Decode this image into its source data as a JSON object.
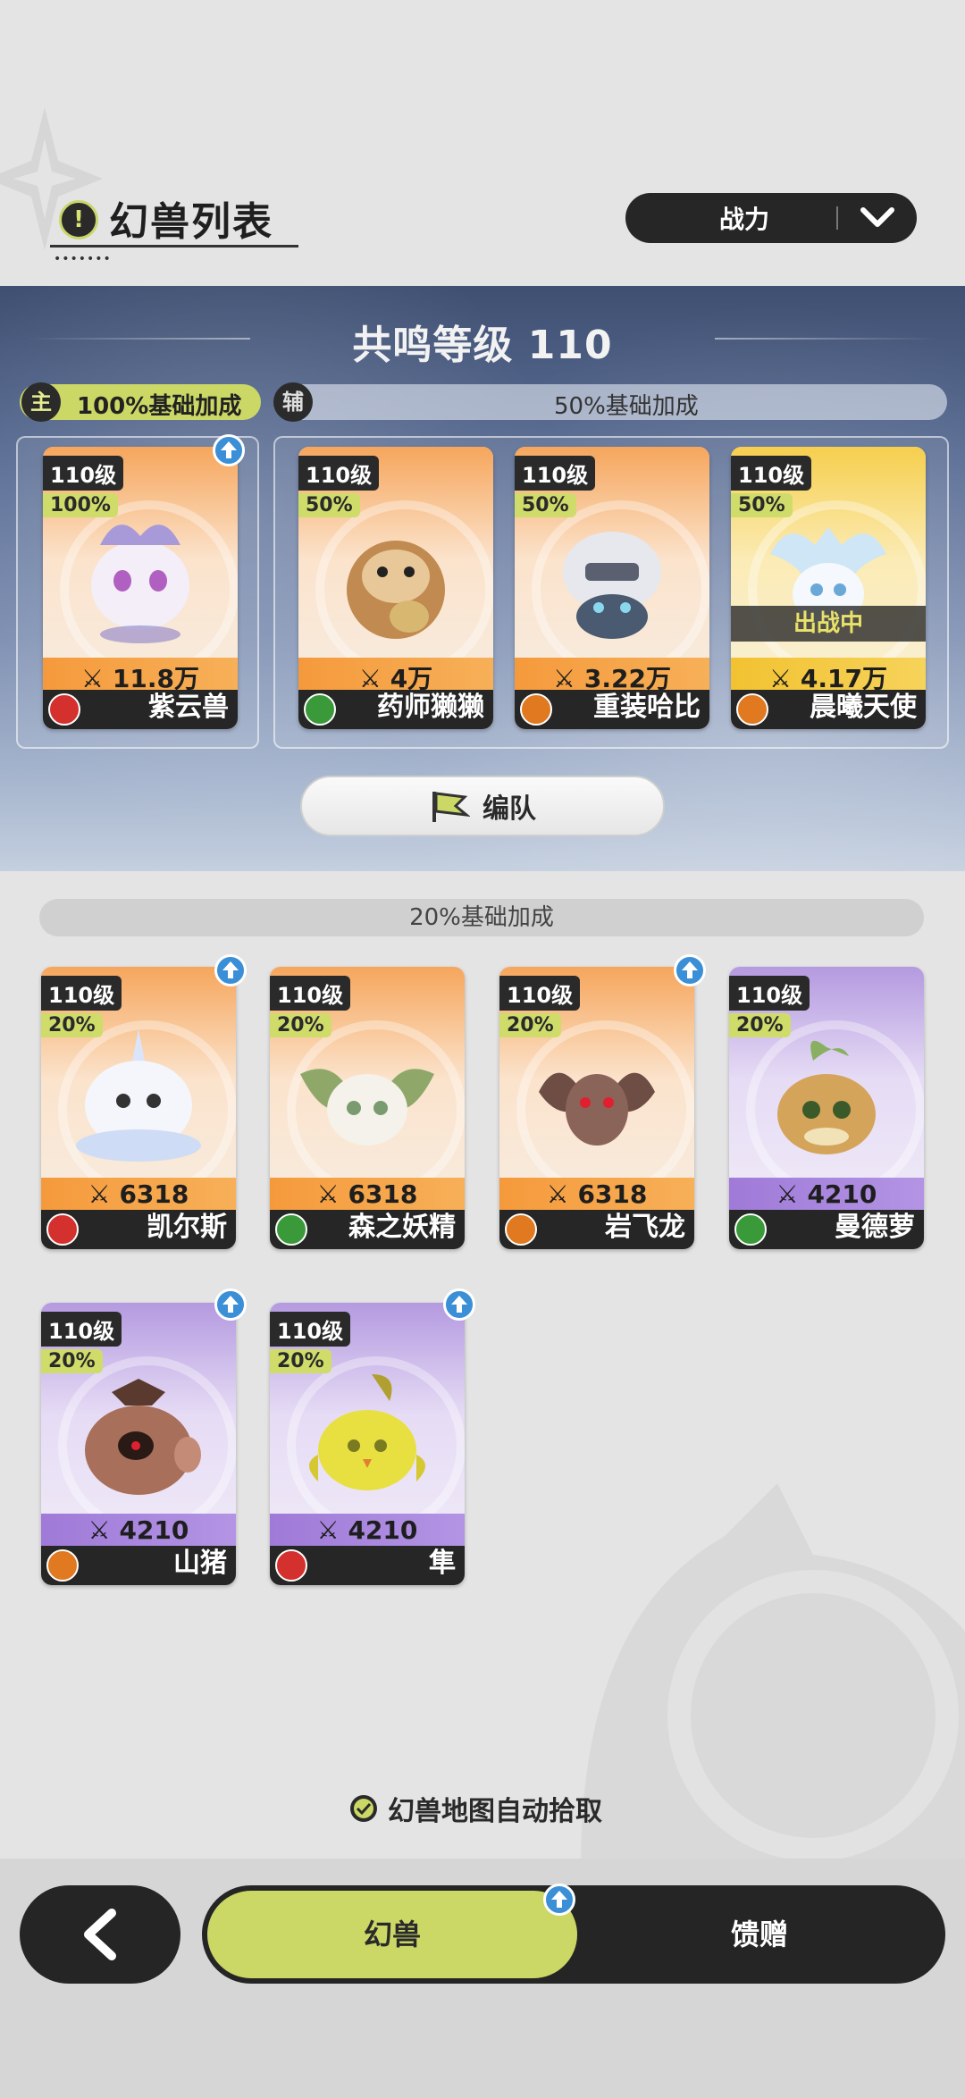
{
  "header": {
    "title": "幻兽列表",
    "title_dots": "•••••••"
  },
  "sort": {
    "label": "战力"
  },
  "resonance": {
    "title": "共鸣等级 110"
  },
  "slots": {
    "main_tag": "主",
    "main_bonus": "100%基础加成",
    "sub_tag": "辅",
    "sub_bonus": "50%基础加成"
  },
  "team_button": {
    "label": "编队"
  },
  "bench": {
    "bonus": "20%基础加成"
  },
  "active_cards": [
    {
      "level": "110级",
      "pct": "100%",
      "power": "11.8万",
      "name": "紫云兽",
      "rarity": "orange",
      "role": "attack",
      "upgrade": true
    },
    {
      "level": "110级",
      "pct": "50%",
      "power": "4万",
      "name": "药师獭獭",
      "rarity": "orange",
      "role": "heal",
      "upgrade": false
    },
    {
      "level": "110级",
      "pct": "50%",
      "power": "3.22万",
      "name": "重装哈比",
      "rarity": "orange",
      "role": "defend",
      "upgrade": false
    },
    {
      "level": "110级",
      "pct": "50%",
      "power": "4.17万",
      "name": "晨曦天使",
      "rarity": "gold",
      "role": "defend",
      "upgrade": false,
      "status": "出战中"
    }
  ],
  "bench_cards": [
    {
      "level": "110级",
      "pct": "20%",
      "power": "6318",
      "name": "凯尔斯",
      "rarity": "orange",
      "role": "attack",
      "upgrade": true
    },
    {
      "level": "110级",
      "pct": "20%",
      "power": "6318",
      "name": "森之妖精",
      "rarity": "orange",
      "role": "heal",
      "upgrade": false
    },
    {
      "level": "110级",
      "pct": "20%",
      "power": "6318",
      "name": "岩飞龙",
      "rarity": "orange",
      "role": "defend",
      "upgrade": true
    },
    {
      "level": "110级",
      "pct": "20%",
      "power": "4210",
      "name": "曼德萝",
      "rarity": "purple",
      "role": "heal",
      "upgrade": false
    },
    {
      "level": "110级",
      "pct": "20%",
      "power": "4210",
      "name": "山猪",
      "rarity": "purple",
      "role": "defend",
      "upgrade": true
    },
    {
      "level": "110级",
      "pct": "20%",
      "power": "4210",
      "name": "隼",
      "rarity": "purple",
      "role": "attack",
      "upgrade": true
    }
  ],
  "auto_pickup": {
    "label": "幻兽地图自动拾取",
    "checked": true
  },
  "tabs": [
    {
      "label": "幻兽",
      "active": true
    },
    {
      "label": "馈赠",
      "active": false
    }
  ],
  "colors": {
    "accent": "#cbd865",
    "dark": "#262626",
    "orange": "#f59a3c",
    "purple": "#9f7ad8",
    "gold": "#f2c231"
  }
}
